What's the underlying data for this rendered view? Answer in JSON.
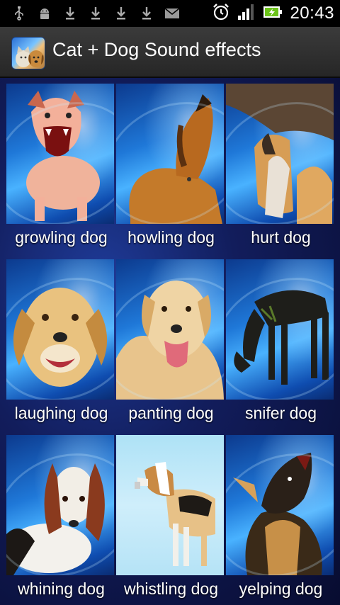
{
  "status_bar": {
    "time": "20:43",
    "notification_icons": [
      "usb-icon",
      "android-debug-icon",
      "download-icon",
      "download-icon",
      "download-icon",
      "download-icon",
      "email-icon"
    ],
    "system_icons": [
      "alarm-clock-icon",
      "signal-strength-icon",
      "battery-charging-icon"
    ]
  },
  "app_bar": {
    "title": "Cat + Dog Sound effects",
    "icon": "cat-dog-app-icon"
  },
  "sounds": [
    {
      "label": "growling dog",
      "image": "growling-dog-photo"
    },
    {
      "label": "howling dog",
      "image": "howling-dog-photo"
    },
    {
      "label": "hurt dog",
      "image": "hurt-dog-photo"
    },
    {
      "label": "laughing dog",
      "image": "laughing-dog-photo"
    },
    {
      "label": "panting dog",
      "image": "panting-dog-photo"
    },
    {
      "label": "snifer dog",
      "image": "sniffer-dog-photo"
    },
    {
      "label": "whining dog",
      "image": "whining-dog-photo"
    },
    {
      "label": "whistling dog",
      "image": "whistling-dog-photo"
    },
    {
      "label": "yelping dog",
      "image": "yelping-dog-photo"
    }
  ]
}
